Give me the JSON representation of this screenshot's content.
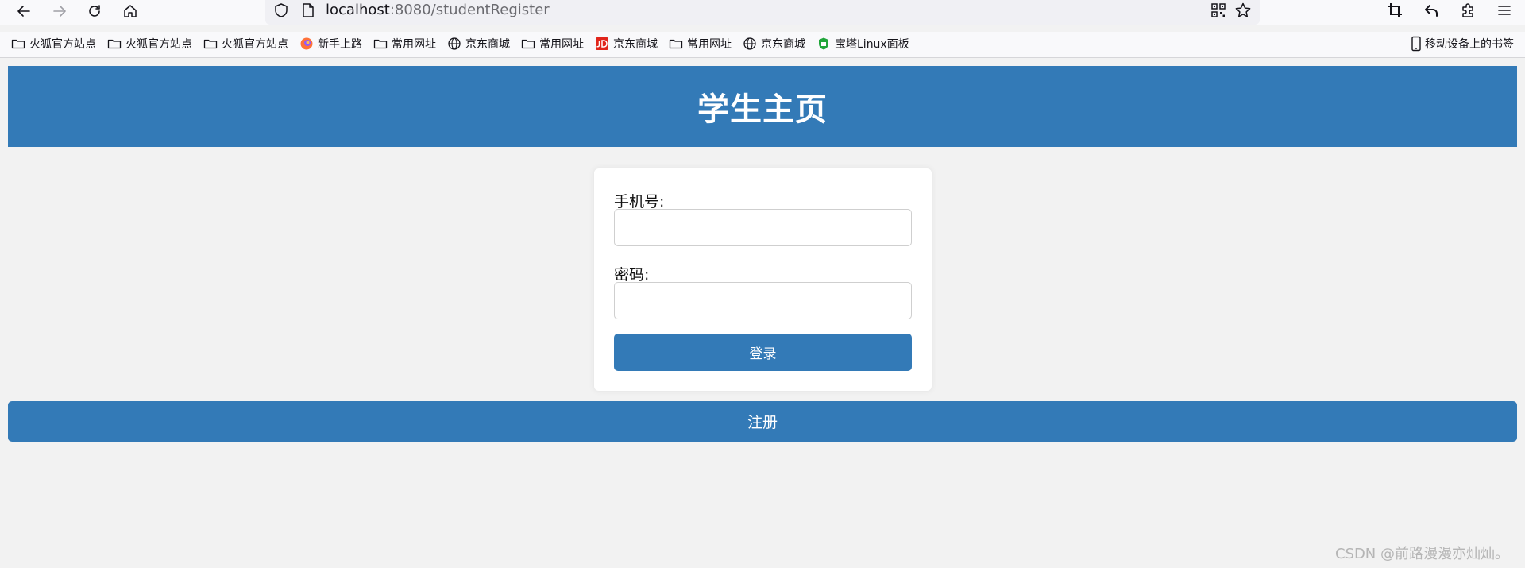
{
  "browser": {
    "url_host": "localhost",
    "url_rest": ":8080/studentRegister",
    "bookmarks": [
      {
        "label": "火狐官方站点",
        "icon": "folder-icon"
      },
      {
        "label": "火狐官方站点",
        "icon": "folder-icon"
      },
      {
        "label": "火狐官方站点",
        "icon": "folder-icon"
      },
      {
        "label": "新手上路",
        "icon": "firefox-icon"
      },
      {
        "label": "常用网址",
        "icon": "folder-icon"
      },
      {
        "label": "京东商城",
        "icon": "globe-icon"
      },
      {
        "label": "常用网址",
        "icon": "folder-icon"
      },
      {
        "label": "京东商城",
        "icon": "jd-icon"
      },
      {
        "label": "常用网址",
        "icon": "folder-icon"
      },
      {
        "label": "京东商城",
        "icon": "globe-icon"
      },
      {
        "label": "宝塔Linux面板",
        "icon": "baota-icon"
      }
    ],
    "mobile_bookmarks": "移动设备上的书签"
  },
  "page": {
    "title": "学生主页",
    "phone_label": "手机号:",
    "phone_value": "",
    "password_label": "密码:",
    "password_value": "",
    "login_label": "登录",
    "register_label": "注册"
  },
  "watermark": "CSDN @前路漫漫亦灿灿。",
  "colors": {
    "primary": "#337ab7",
    "background": "#f2f2f2"
  }
}
